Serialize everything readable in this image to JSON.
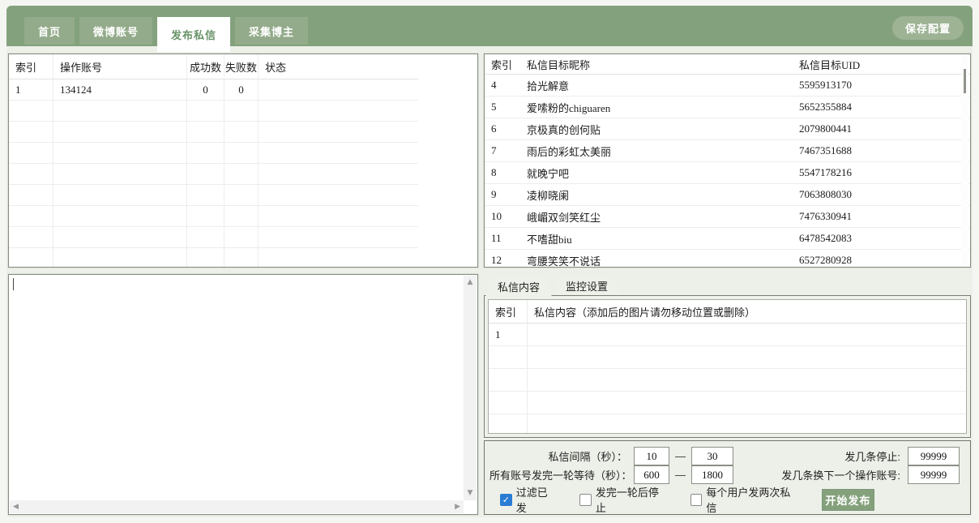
{
  "top": {
    "tabs": [
      {
        "label": "首页",
        "active": false
      },
      {
        "label": "微博账号",
        "active": false
      },
      {
        "label": "发布私信",
        "active": true
      },
      {
        "label": "采集博主",
        "active": false
      }
    ],
    "save_button": "保存配置"
  },
  "accounts_table": {
    "headers": [
      "索引",
      "操作账号",
      "成功数",
      "失败数",
      "状态"
    ],
    "rows": [
      [
        "1",
        "134124",
        "0",
        "0",
        ""
      ]
    ],
    "empty_rows": 8
  },
  "targets_table": {
    "headers": [
      "索引",
      "私信目标昵称",
      "私信目标UID"
    ],
    "rows": [
      [
        "4",
        "拾光解意",
        "5595913170"
      ],
      [
        "5",
        "爱嗦粉的chiguaren",
        "5652355884"
      ],
      [
        "6",
        "京极真的创何贴",
        "2079800441"
      ],
      [
        "7",
        "雨后的彩虹太美丽",
        "7467351688"
      ],
      [
        "8",
        "就晚宁吧",
        "5547178216"
      ],
      [
        "9",
        "凌柳晓阑",
        "7063808030"
      ],
      [
        "10",
        "峨嵋双剑笑红尘",
        "7476330941"
      ],
      [
        "11",
        "不嗜甜biu",
        "6478542083"
      ],
      [
        "12",
        "弯腰笑笑不说话",
        "6527280928"
      ]
    ]
  },
  "content_tabs": {
    "tabs": [
      {
        "label": "私信内容",
        "active": true
      },
      {
        "label": "监控设置",
        "active": false
      }
    ]
  },
  "content_table": {
    "headers": [
      "索引",
      "私信内容（添加后的图片请勿移动位置或删除）"
    ],
    "rows": [
      [
        "1",
        ""
      ]
    ],
    "empty_rows": 4
  },
  "form": {
    "interval_label": "私信间隔（秒）：",
    "interval_min": "10",
    "range_dash": "—",
    "interval_max": "30",
    "stop_label": "发几条停止:",
    "stop_value": "99999",
    "round_label": "所有账号发完一轮等待（秒）：",
    "round_min": "600",
    "round_max": "1800",
    "switch_label": "发几条换下一个操作账号:",
    "switch_value": "99999",
    "checkboxes": [
      {
        "label": "过滤已发",
        "checked": true
      },
      {
        "label": "发完一轮后停止",
        "checked": false
      },
      {
        "label": "每个用户发两次私信",
        "checked": false
      }
    ],
    "start_button": "开始发布"
  },
  "icons": {
    "scroll_up": "▲",
    "scroll_down": "▼",
    "scroll_left": "◀",
    "scroll_right": "▶",
    "check": "✓"
  },
  "colors": {
    "accent_green": "#84a17e",
    "checkbox_blue": "#2b7cd3",
    "active_tab_text": "#679267"
  }
}
